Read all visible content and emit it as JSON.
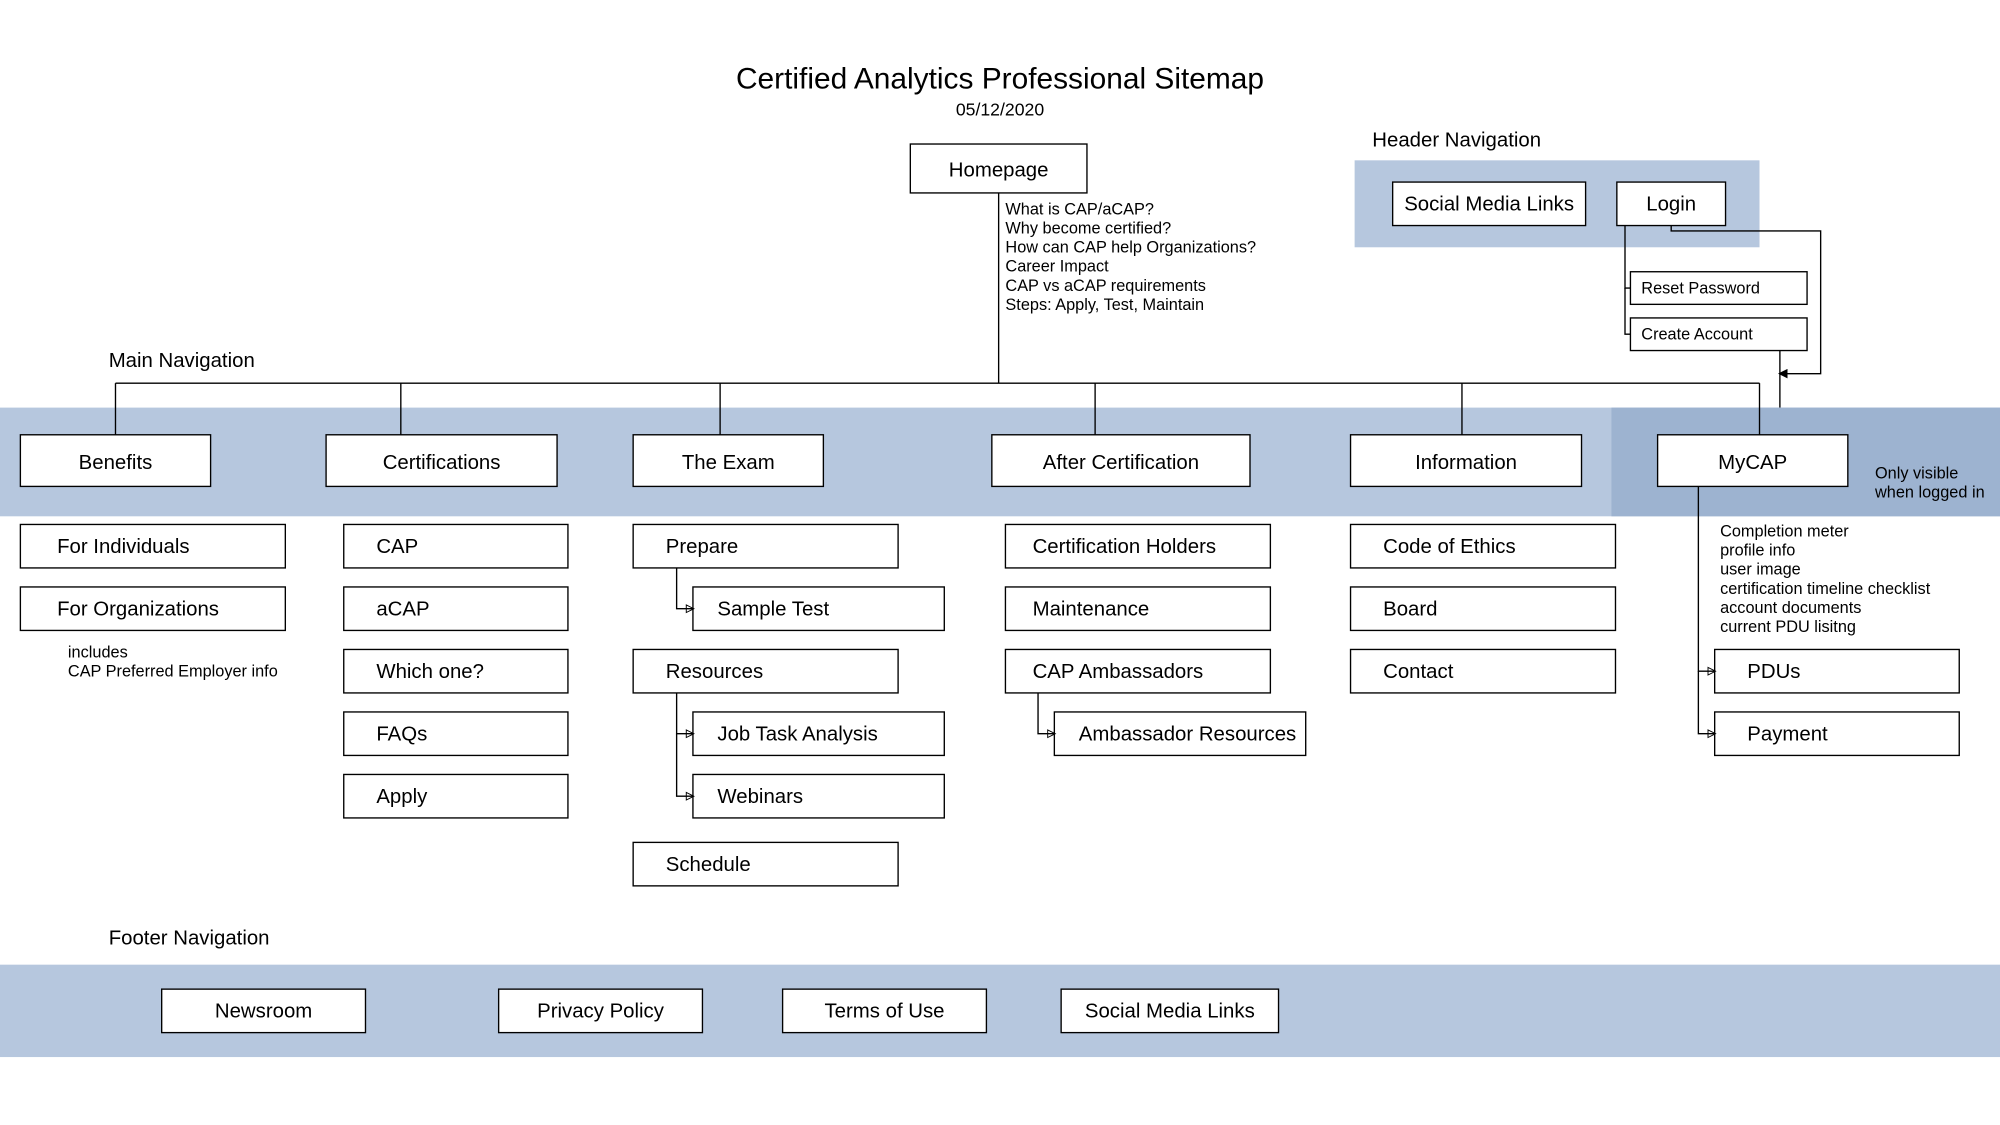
{
  "title": "Certified Analytics Professional Sitemap",
  "date": "05/12/2020",
  "homepage": "Homepage",
  "homepage_notes": [
    "What is CAP/aCAP?",
    "Why become certified?",
    "How can CAP help Organizations?",
    "Career Impact",
    "CAP vs aCAP requirements",
    "Steps: Apply, Test, Maintain"
  ],
  "header_label": "Header Navigation",
  "header": {
    "social": "Social Media Links",
    "login": "Login",
    "reset": "Reset Password",
    "create": "Create Account"
  },
  "main_label": "Main Navigation",
  "logged_in_note": [
    "Only visible",
    "when logged in"
  ],
  "columns": {
    "benefits": {
      "head": "Benefits",
      "items": [
        "For Individuals",
        "For Organizations"
      ],
      "note": [
        "includes",
        "CAP Preferred Employer info"
      ]
    },
    "cert": {
      "head": "Certifications",
      "items": [
        "CAP",
        "aCAP",
        "Which one?",
        "FAQs",
        "Apply"
      ]
    },
    "exam": {
      "head": "The Exam",
      "prepare": "Prepare",
      "sample": "Sample Test",
      "resources": "Resources",
      "jta": "Job Task Analysis",
      "webinars": "Webinars",
      "schedule": "Schedule"
    },
    "after": {
      "head": "After Certification",
      "holders": "Certification Holders",
      "maint": "Maintenance",
      "amb": "CAP Ambassadors",
      "ambres": "Ambassador Resources"
    },
    "info": {
      "head": "Information",
      "items": [
        "Code of Ethics",
        "Board",
        "Contact"
      ]
    },
    "mycap": {
      "head": "MyCAP",
      "notes": [
        "Completion meter",
        "profile info",
        "user image",
        "certification timeline checklist",
        "account documents",
        "current PDU lisitng"
      ],
      "pdus": "PDUs",
      "pay": "Payment"
    }
  },
  "footer_label": "Footer Navigation",
  "footer": [
    "Newsroom",
    "Privacy Policy",
    "Terms of Use",
    "Social Media Links"
  ]
}
